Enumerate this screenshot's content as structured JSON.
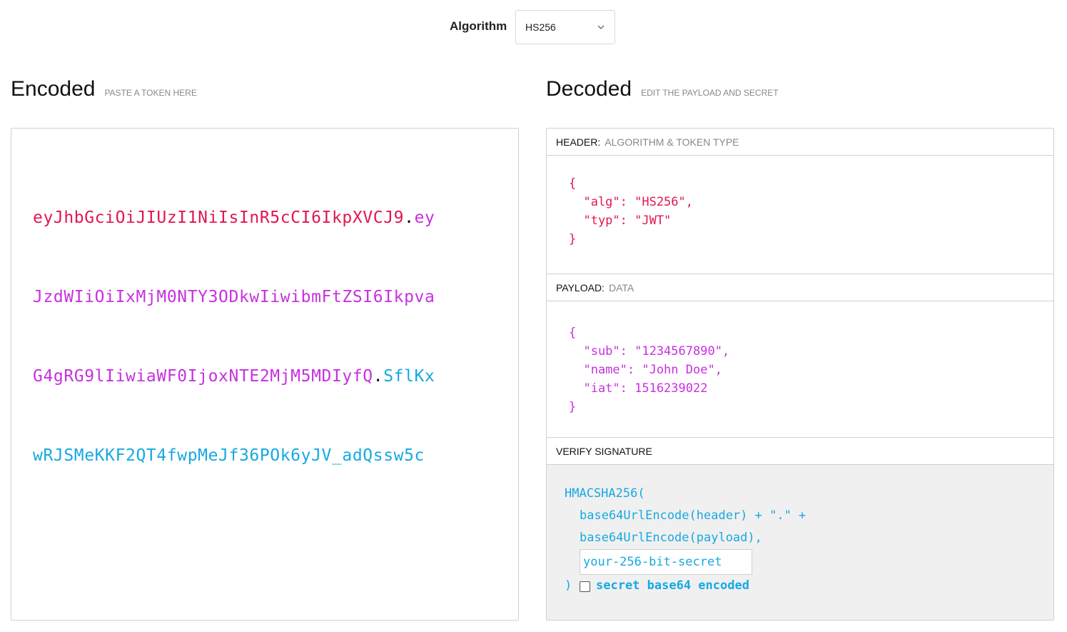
{
  "algorithm": {
    "label": "Algorithm",
    "selected": "HS256"
  },
  "encoded": {
    "title": "Encoded",
    "subtitle": "PASTE A TOKEN HERE",
    "token_lines": [
      {
        "h": "eyJhbGciOiJIUzI1NiIsInR5cCI6IkpXVCJ9",
        "d1": ".",
        "p": "ey",
        "d2": "",
        "s": ""
      },
      {
        "h": "",
        "d1": "",
        "p": "JzdWIiOiIxMjM0NTY3ODkwIiwibmFtZSI6Ikpva",
        "d2": "",
        "s": ""
      },
      {
        "h": "",
        "d1": "",
        "p": "G4gRG9lIiwiaWF0IjoxNTE2MjM5MDIyfQ",
        "d2": ".",
        "s": "SflKx"
      },
      {
        "h": "",
        "d1": "",
        "p": "",
        "d2": "",
        "s": "wRJSMeKKF2QT4fwpMeJf36POk6yJV_adQssw5c"
      }
    ]
  },
  "decoded": {
    "title": "Decoded",
    "subtitle": "EDIT THE PAYLOAD AND SECRET",
    "header_section": {
      "label": "HEADER:",
      "sublabel": "ALGORITHM & TOKEN TYPE",
      "json": "{\n  \"alg\": \"HS256\",\n  \"typ\": \"JWT\"\n}"
    },
    "payload_section": {
      "label": "PAYLOAD:",
      "sublabel": "DATA",
      "json": "{\n  \"sub\": \"1234567890\",\n  \"name\": \"John Doe\",\n  \"iat\": 1516239022\n}"
    },
    "verify_section": {
      "label": "VERIFY SIGNATURE",
      "line1": "HMACSHA256(",
      "line2": "base64UrlEncode(header) + \".\" +",
      "line3": "base64UrlEncode(payload),",
      "secret_placeholder": "your-256-bit-secret",
      "close_paren": ")",
      "checkbox_label": "secret base64 encoded"
    }
  },
  "colors": {
    "header": "#e0174e",
    "payload": "#c830e0",
    "signature": "#16a9e1"
  },
  "icons": {
    "algorithm_dropdown": "chevron-down-icon"
  }
}
